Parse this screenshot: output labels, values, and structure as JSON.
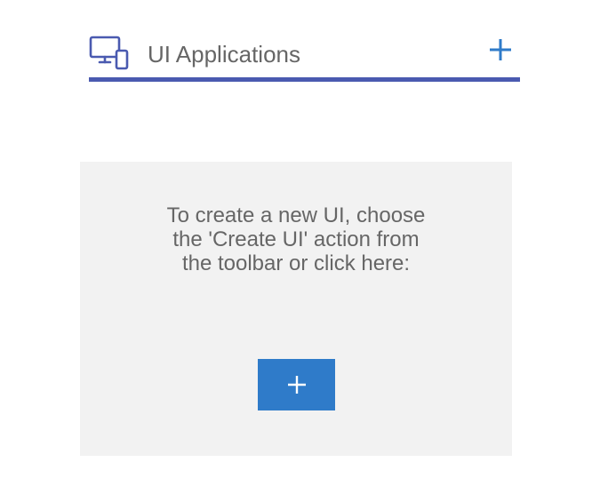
{
  "header": {
    "icon": "devices-icon",
    "title": "UI Applications",
    "add_icon": "plus-icon"
  },
  "empty_state": {
    "message_lines": [
      "To create a new UI, choose",
      "the 'Create UI' action from",
      "the toolbar or click here:"
    ],
    "create_button_icon": "plus-icon"
  },
  "colors": {
    "accent_rule": "#4a5ab0",
    "icon_blue": "#2f7bc9",
    "text_gray": "#666666",
    "panel_bg": "#f2f2f2"
  }
}
